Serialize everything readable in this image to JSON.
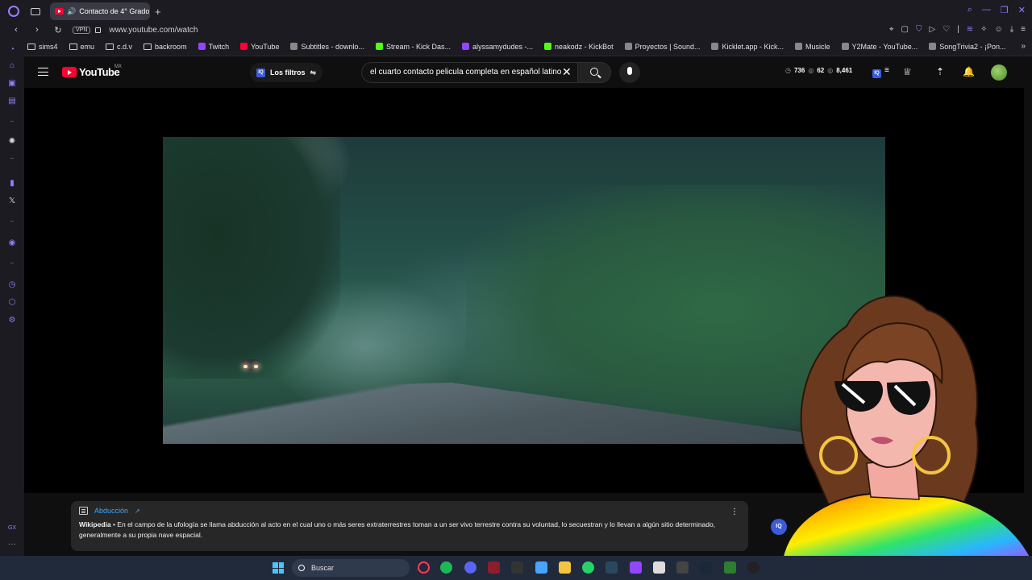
{
  "browser": {
    "tab_title": "Contacto de 4° Grado",
    "url": "www.youtube.com/watch",
    "vpn_label": "VPN",
    "accent": "#9a7cff"
  },
  "bookmarks": [
    {
      "label": "sims4",
      "type": "folder"
    },
    {
      "label": "emu",
      "type": "folder"
    },
    {
      "label": "c.d.v",
      "type": "folder"
    },
    {
      "label": "backroom",
      "type": "folder"
    },
    {
      "label": "Twitch",
      "type": "twitch"
    },
    {
      "label": "YouTube",
      "type": "youtube"
    },
    {
      "label": "Subtitles - downlo...",
      "type": "site"
    },
    {
      "label": "Stream - Kick Das...",
      "type": "kick"
    },
    {
      "label": "alyssamydudes -...",
      "type": "twitch"
    },
    {
      "label": "neakodz - KickBot",
      "type": "kick"
    },
    {
      "label": "Proyectos | Sound...",
      "type": "site"
    },
    {
      "label": "Kicklet.app - Kick...",
      "type": "site"
    },
    {
      "label": "Musicle",
      "type": "site"
    },
    {
      "label": "Y2Mate - YouTube...",
      "type": "site"
    },
    {
      "label": "SongTrivia2 - ¡Pon...",
      "type": "site"
    }
  ],
  "youtube": {
    "logo_text": "YouTube",
    "country": "MX",
    "filters_label": "Los filtros",
    "filters_badge": "IQ",
    "search_value": "el cuarto contacto pelicula completa en español latino",
    "stats": {
      "a": "736",
      "b": "62",
      "c": "8,461"
    }
  },
  "wiki": {
    "title": "Abducción",
    "source": "Wikipedia",
    "text": " • En el campo de la ufología se llama abducción al acto en el cual uno o más seres extraterrestres toman a un ser vivo terrestre contra su voluntad, lo secuestran y lo llevan a algún sitio determinado, generalmente a su propia nave espacial."
  },
  "taskbar": {
    "search_label": "Buscar"
  }
}
